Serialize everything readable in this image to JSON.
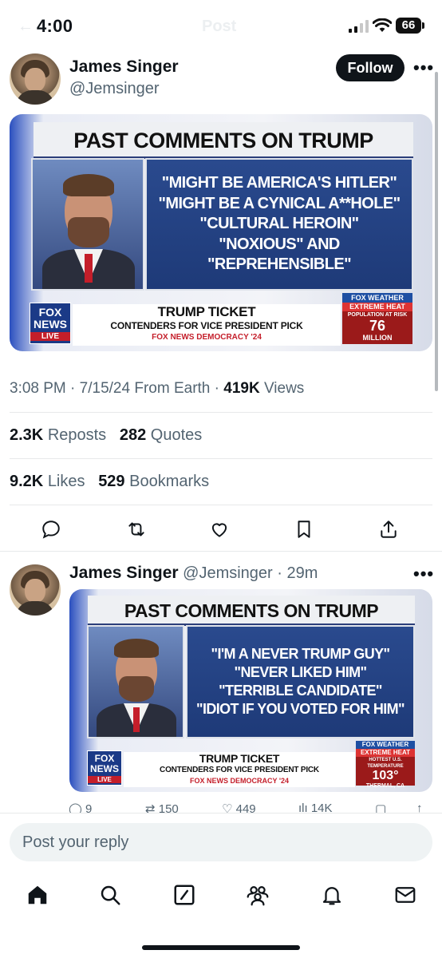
{
  "status_bar": {
    "time": "4:00",
    "battery": "66",
    "back_ghost": "←",
    "header_ghost": "Post"
  },
  "post": {
    "author_name": "James Singer",
    "author_handle": "@Jemsinger",
    "follow_label": "Follow",
    "more": "•••",
    "graphic": {
      "title": "PAST COMMENTS ON TRUMP",
      "quotes": [
        "\"MIGHT BE AMERICA'S HITLER\"",
        "\"MIGHT BE A CYNICAL A**HOLE\"",
        "\"CULTURAL HEROIN\"",
        "\"NOXIOUS\" AND \"REPREHENSIBLE\""
      ],
      "ticker_title": "TRUMP TICKET",
      "ticker_sub": "CONTENDERS FOR VICE PRESIDENT PICK",
      "ticker_tag": "FOX NEWS DEMOCRACY '24",
      "logo_top": "FOX",
      "logo_mid": "NEWS",
      "logo_live": "LIVE",
      "weather_brand": "FOX WEATHER",
      "weather_label": "EXTREME HEAT",
      "weather_sub": "POPULATION AT RISK",
      "weather_value": "76",
      "weather_unit": "MILLION"
    },
    "time": "3:08 PM",
    "date": "7/15/24",
    "source": "From Earth",
    "views_count": "419K",
    "views_label": "Views",
    "reposts_count": "2.3K",
    "reposts_label": "Reposts",
    "quotes_count": "282",
    "quotes_label": "Quotes",
    "likes_count": "9.2K",
    "likes_label": "Likes",
    "bookmarks_count": "529",
    "bookmarks_label": "Bookmarks"
  },
  "reply": {
    "author_name": "James Singer",
    "author_handle": "@Jemsinger",
    "time_ago": "29m",
    "more": "•••",
    "graphic": {
      "title": "PAST COMMENTS ON TRUMP",
      "quotes": [
        "\"I'M A NEVER TRUMP GUY\"",
        "\"NEVER LIKED HIM\"",
        "\"TERRIBLE CANDIDATE\"",
        "\"IDIOT IF YOU VOTED FOR HIM\""
      ],
      "ticker_title": "TRUMP TICKET",
      "ticker_sub": "CONTENDERS FOR VICE PRESIDENT PICK",
      "ticker_tag": "FOX NEWS DEMOCRACY '24",
      "logo_top": "FOX",
      "logo_mid": "NEWS",
      "logo_live": "LIVE",
      "weather_brand": "FOX WEATHER",
      "weather_label": "EXTREME HEAT",
      "weather_sub": "HOTTEST U.S. TEMPERATURE",
      "weather_value": "103°",
      "weather_unit": "THERMAL, CA"
    },
    "replies": "9",
    "reposts": "150",
    "likes": "449",
    "views": "14K"
  },
  "composer": {
    "placeholder": "Post your reply"
  },
  "tabbar": [
    "home-icon",
    "search-icon",
    "grok-icon",
    "communities-icon",
    "notifications-icon",
    "messages-icon"
  ]
}
